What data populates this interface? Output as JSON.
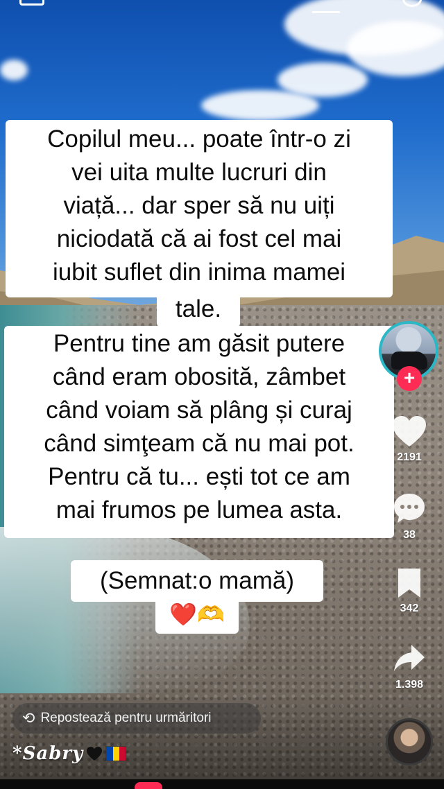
{
  "caption": {
    "paragraph1": [
      "Copilul meu... poate într-o zi",
      "vei uita multe lucruri din",
      "viață... dar sper să nu uiți",
      "niciodată că ai fost cel mai",
      "iubit suflet din inima mamei",
      "tale."
    ],
    "paragraph2": [
      "Pentru tine am găsit putere",
      "când eram obosită, zâmbet",
      "când voiam să plâng și curaj",
      "când simţeam că nu mai pot.",
      "Pentru că tu... ești tot ce am",
      "mai frumos pe lumea asta."
    ],
    "signature": "(Semnat:o mamă)",
    "signature_emojis": "❤️🫶"
  },
  "rail": {
    "like_count": "2191",
    "comment_count": "38",
    "save_count": "342",
    "share_count": "1.398",
    "follow_symbol": "+"
  },
  "repost": {
    "icon": "repost-icon",
    "label": "Repostează pentru urmăritori"
  },
  "creator": {
    "username": "*Sabry",
    "emoji_tail": "🖤🇲🇩"
  },
  "colors": {
    "accent": "#fe2c55",
    "avatar_ring": "#2ab7c6",
    "caption_bg": "#ffffff"
  }
}
